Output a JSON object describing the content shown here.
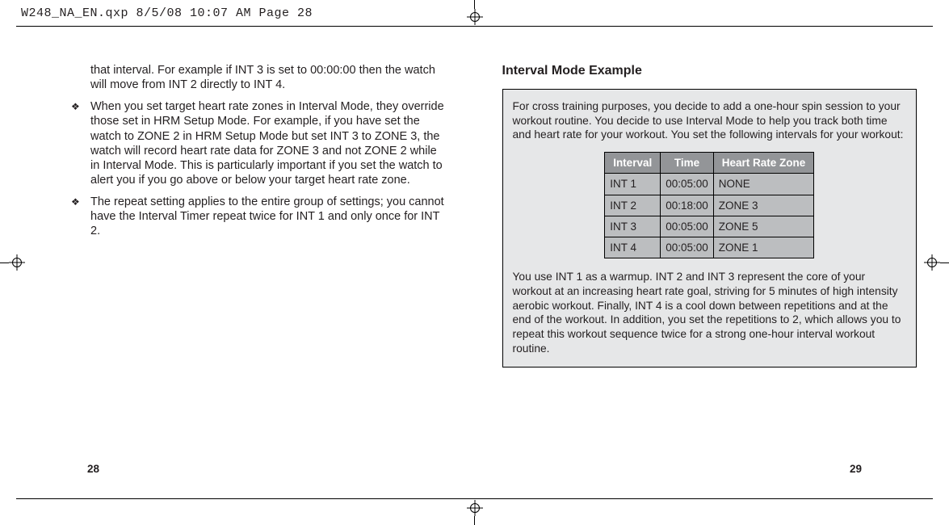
{
  "slug": "W248_NA_EN.qxp   8/5/08  10:07 AM  Page 28",
  "left_page": {
    "continuation": "that interval. For example if INT 3 is set to 00:00:00 then the watch will move from INT 2 directly to INT 4.",
    "bullets": [
      "When you set target heart rate zones in Interval Mode, they override those set in HRM Setup Mode. For example, if you have set the watch to ZONE 2 in HRM Setup Mode but set INT 3 to ZONE 3, the watch will record heart rate data for ZONE 3 and not ZONE 2 while in Interval Mode. This is particularly important if you set the watch to alert you if you go above or below your target heart rate zone.",
      "The repeat setting applies to the entire group of settings; you cannot have the Interval Timer repeat twice for INT 1 and only once for INT 2."
    ],
    "page_number": "28"
  },
  "right_page": {
    "heading": "Interval Mode Example",
    "intro": "For cross training purposes, you decide to add a one-hour spin session to your workout routine. You decide to use Interval Mode to help you track both time and heart rate for your workout. You set the following intervals for your workout:",
    "table": {
      "headers": [
        "Interval",
        "Time",
        "Heart Rate Zone"
      ],
      "rows": [
        [
          "INT 1",
          "00:05:00",
          "NONE"
        ],
        [
          "INT 2",
          "00:18:00",
          "ZONE 3"
        ],
        [
          "INT 3",
          "00:05:00",
          "ZONE 5"
        ],
        [
          "INT 4",
          "00:05:00",
          "ZONE 1"
        ]
      ]
    },
    "outro": "You use INT 1 as a warmup. INT 2 and INT 3 represent the core of your workout at an increasing heart rate goal, striving for 5 minutes of high intensity aerobic workout. Finally, INT 4 is a cool down between repetitions and at the end of the workout. In addition, you set the repetitions to 2, which allows you to repeat this workout sequence twice for a strong one-hour interval workout routine.",
    "page_number": "29"
  }
}
